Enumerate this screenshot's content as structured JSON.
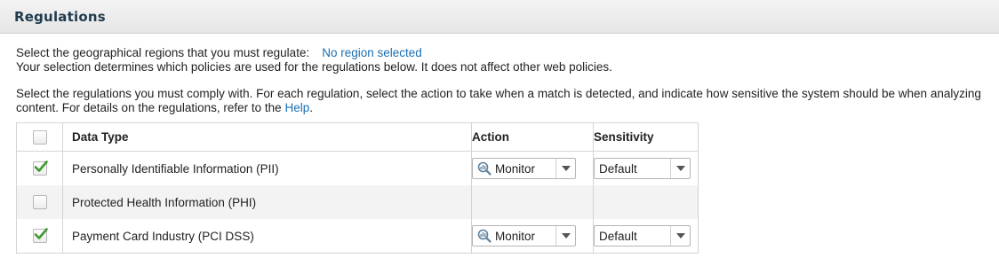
{
  "header": {
    "title": "Regulations"
  },
  "region": {
    "prompt": "Select the geographical regions that you must regulate:",
    "link_label": "No region selected",
    "note": "Your selection determines which policies are used for the regulations below. It does not affect other web policies."
  },
  "instructions": {
    "line1": "Select the regulations you must comply with. For each regulation, select the action to take when a match is detected, and indicate how sensitive the system should be when analyzing",
    "line2_prefix": "content. For details on the regulations, refer to the",
    "help_link": "Help",
    "line2_suffix": "."
  },
  "table": {
    "columns": {
      "data_type": "Data Type",
      "action": "Action",
      "sensitivity": "Sensitivity"
    },
    "rows": [
      {
        "checked": true,
        "data_type": "Personally Identifiable Information (PII)",
        "action": "Monitor",
        "action_icon": "monitor-icon",
        "sensitivity": "Default"
      },
      {
        "checked": false,
        "data_type": "Protected Health Information (PHI)",
        "action": "",
        "sensitivity": ""
      },
      {
        "checked": true,
        "data_type": "Payment Card Industry (PCI DSS)",
        "action": "Monitor",
        "action_icon": "monitor-icon",
        "sensitivity": "Default"
      }
    ]
  },
  "colors": {
    "link": "#1a6fb3",
    "check": "#3c9a2e",
    "title": "#1f3a4d"
  }
}
